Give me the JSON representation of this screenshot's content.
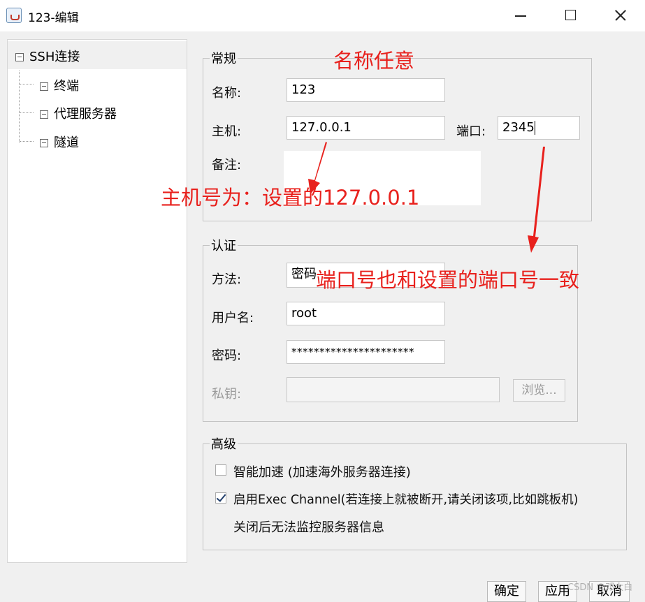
{
  "window": {
    "title": "123-编辑",
    "icon": "java-cup-icon"
  },
  "tree": {
    "root": "SSH连接",
    "children": [
      "终端",
      "代理服务器",
      "隧道"
    ]
  },
  "general": {
    "legend": "常规",
    "name_label": "名称:",
    "name_value": "123",
    "host_label": "主机:",
    "host_value": "127.0.0.1",
    "port_label": "端口:",
    "port_value": "2345",
    "note_label": "备注:",
    "note_value": ""
  },
  "auth": {
    "legend": "认证",
    "method_label": "方法:",
    "method_value": "密码",
    "user_label": "用户名:",
    "user_value": "root",
    "password_label": "密码:",
    "password_value": "**********************",
    "key_label": "私钥:",
    "key_value": "",
    "browse_label": "浏览..."
  },
  "advanced": {
    "legend": "高级",
    "accel_label": "智能加速 (加速海外服务器连接)",
    "accel_checked": false,
    "exec_label": "启用Exec Channel(若连接上就被断开,请关闭该项,比如跳板机)",
    "exec_checked": true,
    "exec_note": "关闭后无法监控服务器信息"
  },
  "buttons": {
    "ok": "确定",
    "apply": "应用",
    "cancel": "取消"
  },
  "annotations": {
    "name_hint": "名称任意",
    "host_hint": "主机号为：设置的127.0.0.1",
    "port_hint": "端口号也和设置的端口号一致",
    "color": "#e8211d"
  },
  "watermark": "CSDN @邓太白"
}
